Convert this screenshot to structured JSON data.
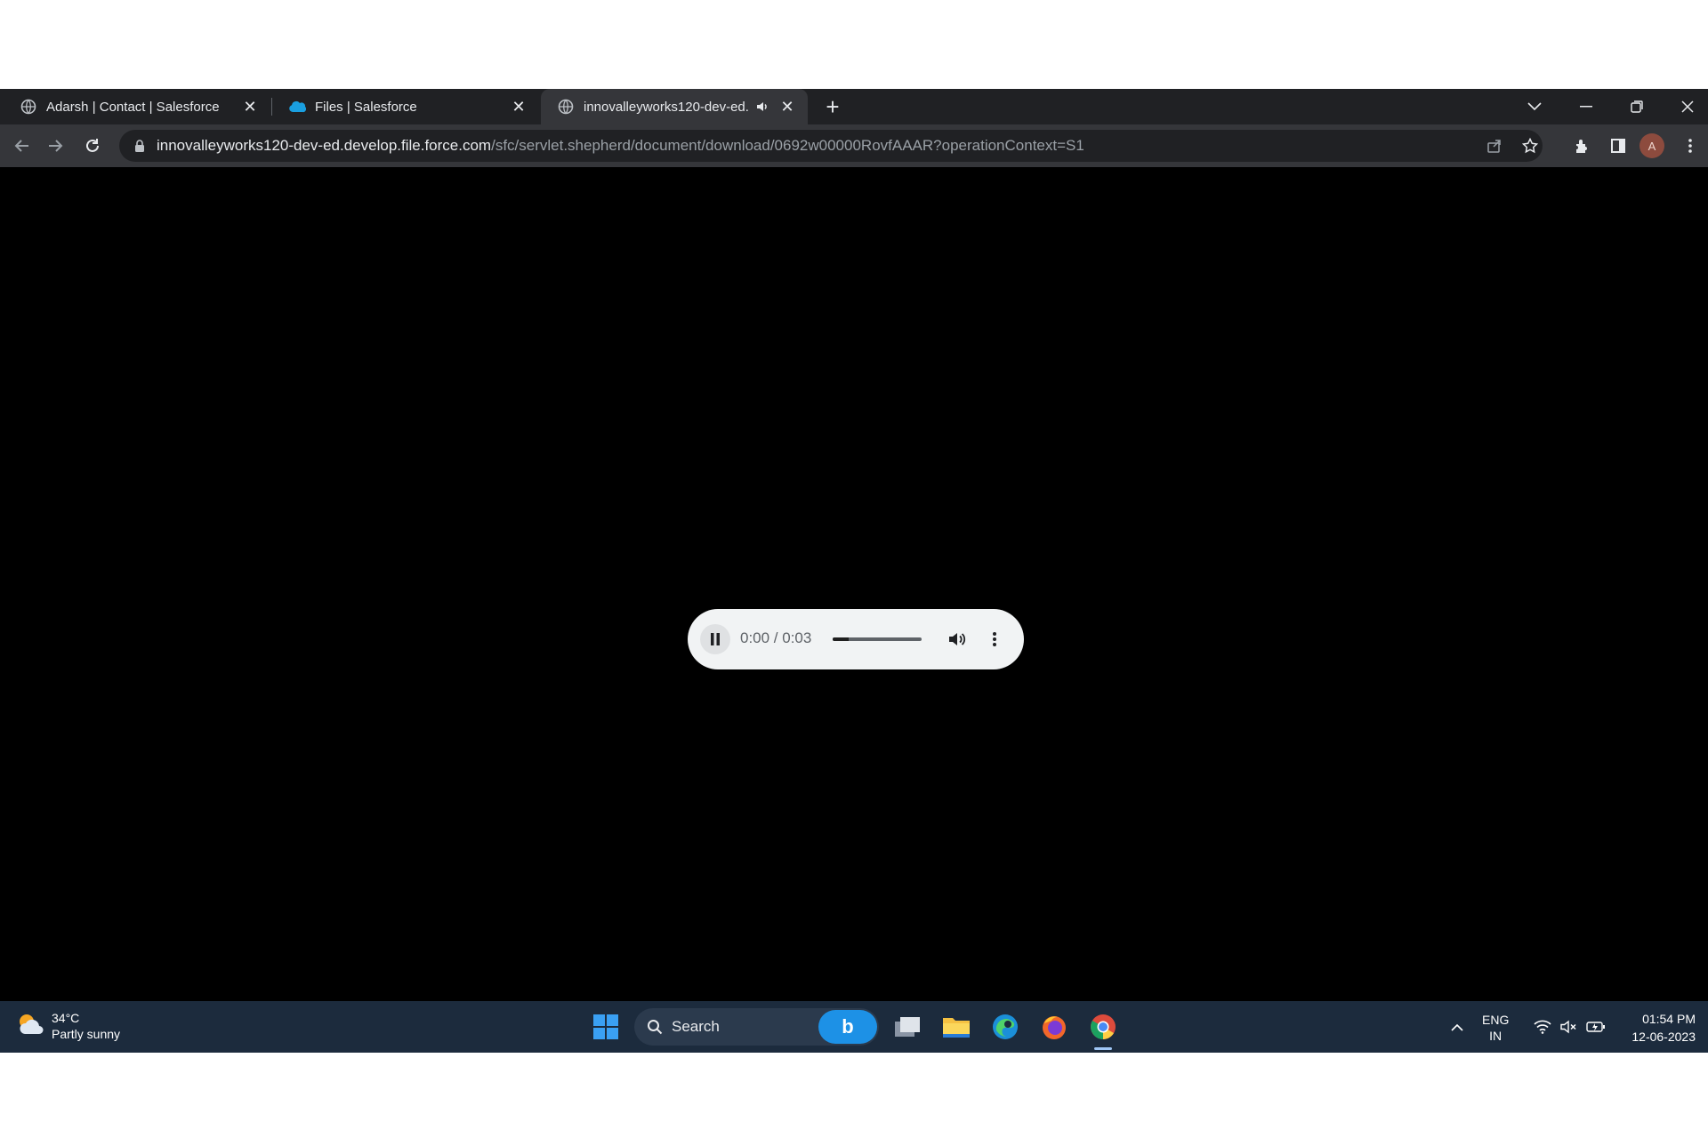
{
  "browser": {
    "tabs": [
      {
        "title": "Adarsh | Contact | Salesforce",
        "favicon": "globe-icon",
        "active": false
      },
      {
        "title": "Files | Salesforce",
        "favicon": "salesforce-cloud-icon",
        "active": false
      },
      {
        "title": "innovalleyworks120-dev-ed.d",
        "favicon": "globe-icon",
        "active": true,
        "muted_indicator": "speaker-icon"
      }
    ],
    "new_tab_label": "+",
    "url_host": "innovalleyworks120-dev-ed.develop.file.force.com",
    "url_path": "/sfc/servlet.shepherd/document/download/0692w00000RovfAAAR?operationContext=S1",
    "profile_initial": "A"
  },
  "player": {
    "state": "playing",
    "time_display": "0:00 / 0:03",
    "progress_fraction": 0.0,
    "volume_fraction": 0.2
  },
  "taskbar": {
    "weather_temp": "34°C",
    "weather_desc": "Partly sunny",
    "search_label": "Search",
    "bing_label": "b",
    "lang_top": "ENG",
    "lang_bottom": "IN",
    "time": "01:54 PM",
    "date": "12-06-2023"
  },
  "colors": {
    "tabstrip": "#202124",
    "toolbar": "#35363a",
    "page_bg": "#000000",
    "player_bg": "#f1f3f4",
    "taskbar": "#1c2b3d",
    "accent_blue": "#1d91e6"
  }
}
